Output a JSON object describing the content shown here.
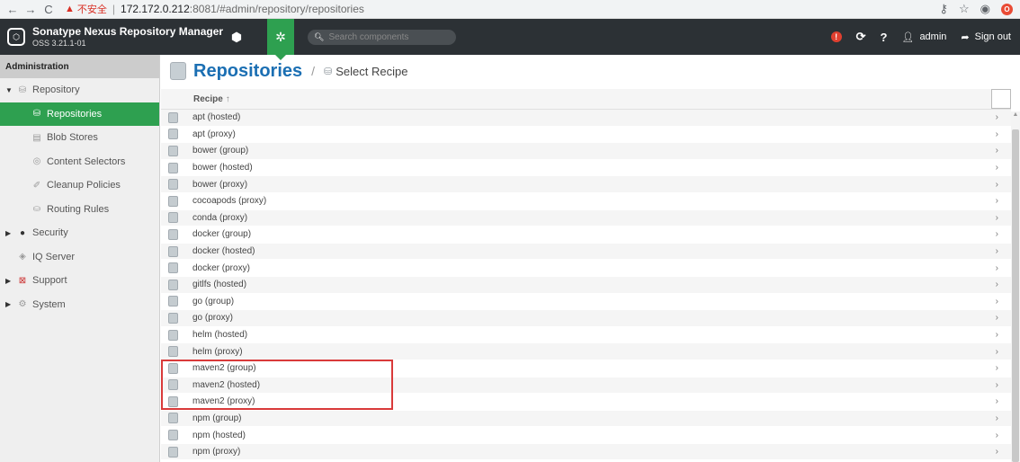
{
  "browser": {
    "insecure_label": "不安全",
    "url_host": "172.172.0.212",
    "url_rest": ":8081/#admin/repository/repositories"
  },
  "header": {
    "app_name": "Sonatype Nexus Repository Manager",
    "version": "OSS 3.21.1-01",
    "search_placeholder": "Search components",
    "user": "admin",
    "signout": "Sign out"
  },
  "sidebar": {
    "title": "Administration",
    "items": [
      {
        "label": "Repository"
      },
      {
        "label": "Repositories"
      },
      {
        "label": "Blob Stores"
      },
      {
        "label": "Content Selectors"
      },
      {
        "label": "Cleanup Policies"
      },
      {
        "label": "Routing Rules"
      },
      {
        "label": "Security"
      },
      {
        "label": "IQ Server"
      },
      {
        "label": "Support"
      },
      {
        "label": "System"
      }
    ]
  },
  "main": {
    "title": "Repositories",
    "subtitle": "Select Recipe",
    "column_header": "Recipe",
    "recipes": [
      "apt (hosted)",
      "apt (proxy)",
      "bower (group)",
      "bower (hosted)",
      "bower (proxy)",
      "cocoapods (proxy)",
      "conda (proxy)",
      "docker (group)",
      "docker (hosted)",
      "docker (proxy)",
      "gitlfs (hosted)",
      "go (group)",
      "go (proxy)",
      "helm (hosted)",
      "helm (proxy)",
      "maven2 (group)",
      "maven2 (hosted)",
      "maven2 (proxy)",
      "npm (group)",
      "npm (hosted)",
      "npm (proxy)"
    ]
  },
  "colors": {
    "accent_green": "#2ea050",
    "header_dark": "#2c3135",
    "title_blue": "#1b6fb3",
    "highlight_red": "#d93a3a"
  }
}
